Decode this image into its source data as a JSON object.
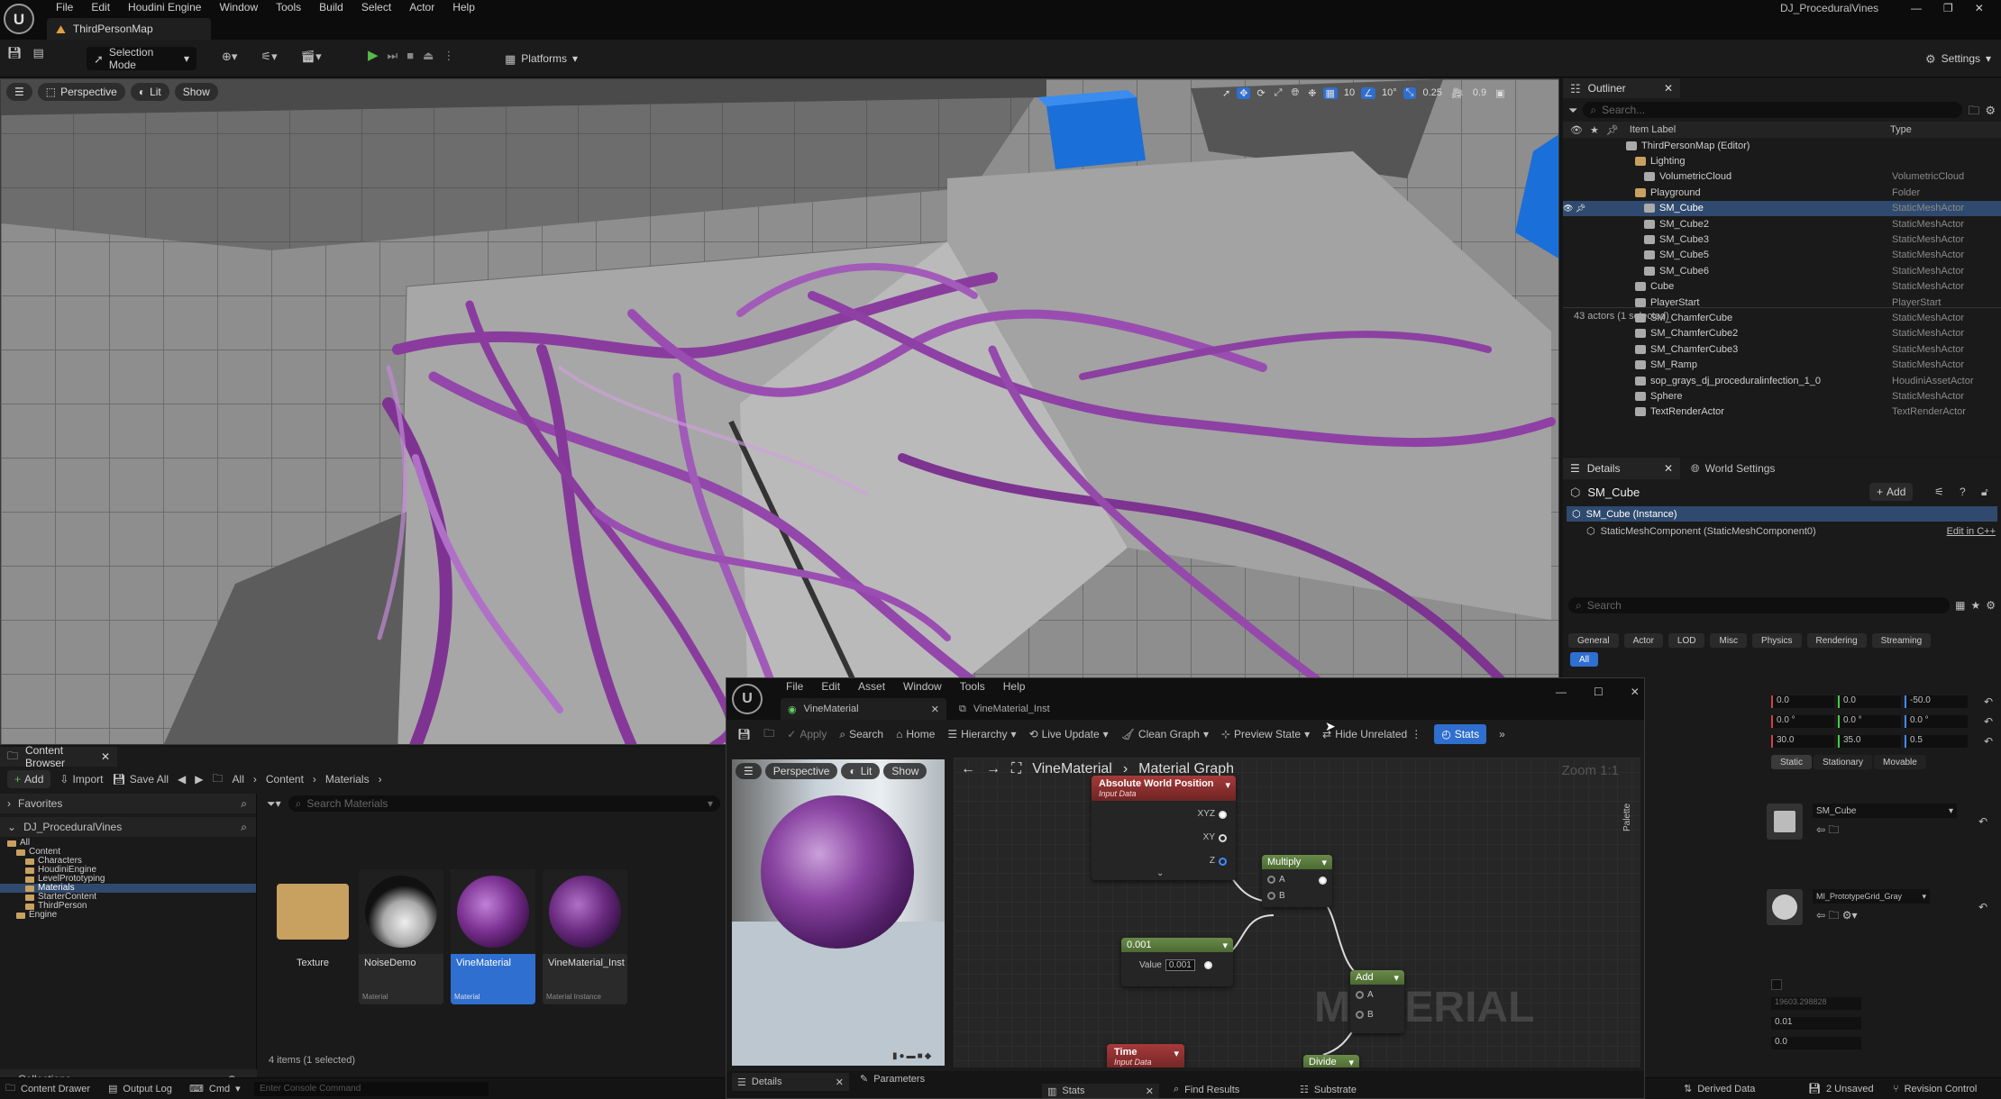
{
  "app": {
    "menus": [
      "File",
      "Edit",
      "Houdini Engine",
      "Window",
      "Tools",
      "Build",
      "Select",
      "Actor",
      "Help"
    ],
    "map_tab": "ThirdPersonMap",
    "project_name": "DJ_ProceduralVines"
  },
  "toolbar": {
    "selection_mode": "Selection Mode",
    "platforms": "Platforms",
    "settings": "Settings"
  },
  "viewport": {
    "perspective": "Perspective",
    "lit": "Lit",
    "show": "Show",
    "grid_snap": "10",
    "rot_snap": "10°",
    "scale_snap": "0.25",
    "cam_speed": "0.9"
  },
  "outliner": {
    "tab": "Outliner",
    "search_placeholder": "Search...",
    "col_label": "Item Label",
    "col_type": "Type",
    "items": [
      {
        "label": "ThirdPersonMap (Editor)",
        "type": "",
        "indent": 0
      },
      {
        "label": "Lighting",
        "type": "",
        "indent": 1
      },
      {
        "label": "VolumetricCloud",
        "type": "VolumetricCloud",
        "indent": 2
      },
      {
        "label": "Playground",
        "type": "Folder",
        "indent": 1
      },
      {
        "label": "SM_Cube",
        "type": "StaticMeshActor",
        "indent": 2
      },
      {
        "label": "SM_Cube2",
        "type": "StaticMeshActor",
        "indent": 2
      },
      {
        "label": "SM_Cube3",
        "type": "StaticMeshActor",
        "indent": 2
      },
      {
        "label": "SM_Cube5",
        "type": "StaticMeshActor",
        "indent": 2
      },
      {
        "label": "SM_Cube6",
        "type": "StaticMeshActor",
        "indent": 2
      },
      {
        "label": "Cube",
        "type": "StaticMeshActor",
        "indent": 1
      },
      {
        "label": "PlayerStart",
        "type": "PlayerStart",
        "indent": 1
      },
      {
        "label": "SM_ChamferCube",
        "type": "StaticMeshActor",
        "indent": 1
      },
      {
        "label": "SM_ChamferCube2",
        "type": "StaticMeshActor",
        "indent": 1
      },
      {
        "label": "SM_ChamferCube3",
        "type": "StaticMeshActor",
        "indent": 1
      },
      {
        "label": "SM_Ramp",
        "type": "StaticMeshActor",
        "indent": 1
      },
      {
        "label": "sop_grays_dj_proceduralinfection_1_0",
        "type": "HoudiniAssetActor",
        "indent": 1
      },
      {
        "label": "Sphere",
        "type": "StaticMeshActor",
        "indent": 1
      },
      {
        "label": "TextRenderActor",
        "type": "TextRenderActor",
        "indent": 1
      }
    ],
    "status": "43 actors (1 selected)"
  },
  "details": {
    "tab": "Details",
    "world_tab": "World Settings",
    "actor": "SM_Cube",
    "add": "Add",
    "instance": "SM_Cube (Instance)",
    "component": "StaticMeshComponent (StaticMeshComponent0)",
    "edit_cpp": "Edit in C++",
    "search_placeholder": "Search",
    "categories": [
      "General",
      "Actor",
      "LOD",
      "Misc",
      "Physics",
      "Rendering",
      "Streaming"
    ],
    "all": "All",
    "loc": [
      "0.0",
      "0.0",
      "-50.0"
    ],
    "rot": [
      "0.0 °",
      "0.0 °",
      "0.0 °"
    ],
    "scale": [
      "30.0",
      "35.0",
      "0.5"
    ],
    "mobility": [
      "Static",
      "Stationary",
      "Movable"
    ],
    "mesh": "SM_Cube",
    "material": "MI_PrototypeGrid_Gray",
    "val1": "19603.298828",
    "val2": "0.01",
    "val3": "0.0"
  },
  "content_browser": {
    "tab": "Content Browser",
    "add": "Add",
    "import": "Import",
    "save_all": "Save All",
    "breadcrumb": [
      "All",
      "Content",
      "Materials"
    ],
    "favorites": "Favorites",
    "project": "DJ_ProceduralVines",
    "search_placeholder": "Search Materials",
    "tree": [
      {
        "label": "All",
        "indent": 0
      },
      {
        "label": "Content",
        "indent": 1
      },
      {
        "label": "Characters",
        "indent": 2
      },
      {
        "label": "HoudiniEngine",
        "indent": 2
      },
      {
        "label": "LevelPrototyping",
        "indent": 2
      },
      {
        "label": "Materials",
        "indent": 2
      },
      {
        "label": "StarterContent",
        "indent": 2
      },
      {
        "label": "ThirdPerson",
        "indent": 2
      },
      {
        "label": "Engine",
        "indent": 1
      }
    ],
    "assets": [
      {
        "name": "Texture",
        "type": ""
      },
      {
        "name": "NoiseDemo",
        "type": "Material"
      },
      {
        "name": "VineMaterial",
        "type": "Material"
      },
      {
        "name": "VineMaterial_Inst",
        "type": "Material Instance"
      }
    ],
    "collections": "Collections",
    "count": "4 items (1 selected)"
  },
  "statusbar": {
    "content_drawer": "Content Drawer",
    "output_log": "Output Log",
    "cmd": "Cmd",
    "console_placeholder": "Enter Console Command",
    "derived_data": "Derived Data",
    "unsaved": "2 Unsaved",
    "revision": "Revision Control"
  },
  "material_editor": {
    "menus": [
      "File",
      "Edit",
      "Asset",
      "Window",
      "Tools",
      "Help"
    ],
    "tab": "VineMaterial",
    "tab2": "VineMaterial_Inst",
    "apply": "Apply",
    "search": "Search",
    "home": "Home",
    "hierarchy": "Hierarchy",
    "live_update": "Live Update",
    "clean_graph": "Clean Graph",
    "preview_state": "Preview State",
    "hide_unrelated": "Hide Unrelated",
    "stats": "Stats",
    "preview_perspective": "Perspective",
    "preview_lit": "Lit",
    "preview_show": "Show",
    "breadcrumb_root": "VineMaterial",
    "breadcrumb_graph": "Material Graph",
    "zoom": "Zoom 1:1",
    "palette": "Palette",
    "watermark": "MATERIAL",
    "node_awp": "Absolute World Position",
    "node_awp_sub": "Input Data",
    "pins": [
      "XYZ",
      "XY",
      "Z"
    ],
    "node_multiply": "Multiply",
    "pin_a": "A",
    "pin_b": "B",
    "node_const": "0.001",
    "value_label": "Value",
    "value": "0.001",
    "node_add": "Add",
    "node_time": "Time",
    "node_time_sub": "Input Data",
    "node_divide": "Divide",
    "bottom_tabs": [
      "Details",
      "Parameters"
    ],
    "bottom_tabs2": [
      "Stats",
      "Find Results",
      "Substrate"
    ]
  }
}
